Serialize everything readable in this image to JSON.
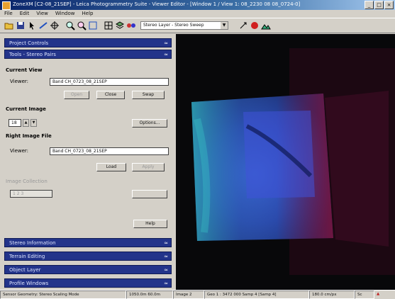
{
  "window": {
    "title": "ZoneXM [C2-08_21SEP] - Leica Photogrammetry Suite - Viewer Editor - [Window 1 / View 1: 08_2230 08 08_0724-0]"
  },
  "menubar": {
    "items": [
      "File",
      "Edit",
      "View",
      "Window",
      "Help"
    ]
  },
  "toolbar": {
    "layer_combo_value": "Stereo Layer - Stereo Sweep"
  },
  "panel": {
    "sections": {
      "top": [
        "Project Controls",
        "Tools - Stereo Pairs"
      ],
      "bottom": [
        "Stereo Information",
        "Terrain Editing",
        "Object Layer",
        "Profile Windows"
      ]
    },
    "left_image_heading": "Current View",
    "left_image_label": "Viewer:",
    "left_image_value": "Band CH_0723_08_21SEP",
    "left_buttons": [
      "Open",
      "Close",
      "Swap"
    ],
    "sync_heading": "Current Image",
    "sync_value": "18",
    "sync_button": "Options...",
    "right_image_heading": "Right Image File",
    "right_image_label": "Viewer:",
    "right_image_value": "Band CH_0723_08_21SEP",
    "right_buttons": [
      "Load",
      "Apply"
    ],
    "disabled_heading": "Image Collection",
    "disabled_value": "1  2  3",
    "help_button": "Help"
  },
  "statusbar": {
    "cells": [
      "Sensor Geometry: Stereo Scaling Mode",
      "1050.0m 60.0m",
      "Image 2",
      "Geo 1 : 3472 000 Samp 4 [Samp 4]",
      "180.0 cm/px",
      "Sc"
    ]
  },
  "colors": {
    "section_header": "#23348a",
    "title_gradient_start": "#0a246a",
    "viewport_bg": "#0a0a0c"
  }
}
